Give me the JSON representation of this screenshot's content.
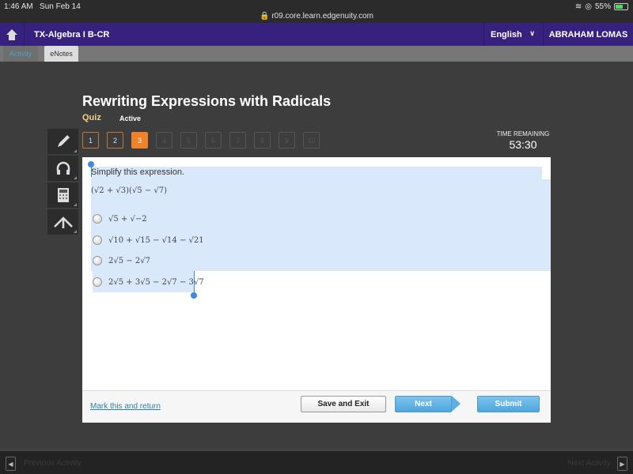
{
  "status_bar": {
    "time": "1:46 AM",
    "date": "Sun Feb 14",
    "url": "r09.core.learn.edgenuity.com",
    "battery": "55%"
  },
  "topbar": {
    "course": "TX-Algebra I B-CR",
    "language": "English",
    "user": "ABRAHAM LOMAS"
  },
  "tabs": [
    {
      "label": "Activity"
    },
    {
      "label": "eNotes"
    }
  ],
  "activity": {
    "title": "Rewriting Expressions with Radicals",
    "type": "Quiz",
    "state": "Active"
  },
  "question_nav": [
    "1",
    "2",
    "3",
    "4",
    "5",
    "6",
    "7",
    "8",
    "9",
    "10"
  ],
  "current_question": 3,
  "timer": {
    "label": "TIME REMAINING",
    "value": "53:30"
  },
  "question": {
    "prompt": "Simplify this expression.",
    "expression": "(√2 + √3)(√5 − √7)",
    "options": [
      {
        "text": "√5 + √−2"
      },
      {
        "text": "√10 + √15 − √14 − √21"
      },
      {
        "text": "2√5 − 2√7"
      },
      {
        "text": "2√5 + 3√5 − 2√7 − 3√7"
      }
    ]
  },
  "footer": {
    "mark_link": "Mark this and return",
    "save_exit": "Save and Exit",
    "next": "Next",
    "submit": "Submit"
  },
  "bottom_nav": {
    "previous": "Previous Activity",
    "next": "Next Activity"
  },
  "colors": {
    "header": "#37217f",
    "current_question": "#f0822a",
    "selection": "#dae8fc",
    "primary_button": "#4ea6dc"
  }
}
